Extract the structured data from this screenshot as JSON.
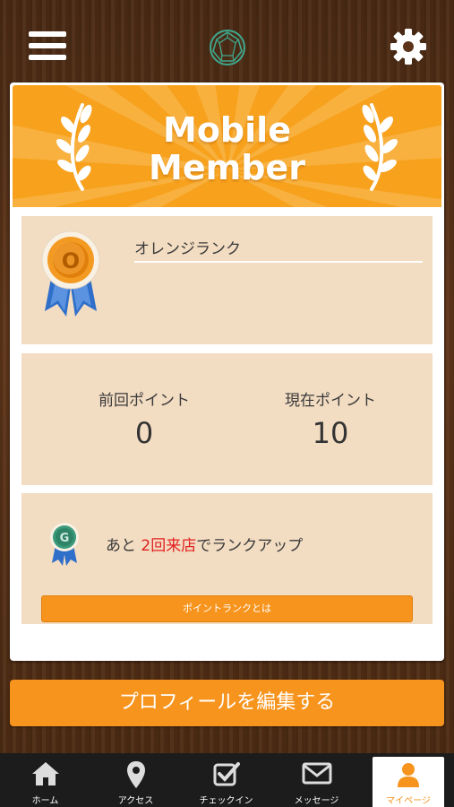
{
  "header": {
    "menu_icon": "hamburger-menu-icon",
    "logo_icon": "diamond-logo-icon",
    "settings_icon": "gear-icon"
  },
  "banner": {
    "line1": "Mobile",
    "line2": "Member",
    "bg_color": "#f7a11d"
  },
  "rank": {
    "name": "オレンジランク",
    "medal_letter": "O"
  },
  "points": {
    "previous_label": "前回ポイント",
    "previous_value": "0",
    "current_label": "現在ポイント",
    "current_value": "10"
  },
  "next_rank": {
    "medal_letter": "G",
    "prefix": "あと ",
    "highlight": "2回来店",
    "suffix": "でランクアップ",
    "button_label": "ポイントランクとは",
    "highlight_color": "#e21f1f"
  },
  "profile_button": "プロフィールを編集する",
  "accent_color": "#f7941d",
  "tabs": [
    {
      "label": "ホーム",
      "icon": "home-icon"
    },
    {
      "label": "アクセス",
      "icon": "map-pin-icon"
    },
    {
      "label": "チェックイン",
      "icon": "checkbox-icon"
    },
    {
      "label": "メッセージ",
      "icon": "envelope-icon"
    },
    {
      "label": "マイページ",
      "icon": "person-icon",
      "active": true
    }
  ]
}
